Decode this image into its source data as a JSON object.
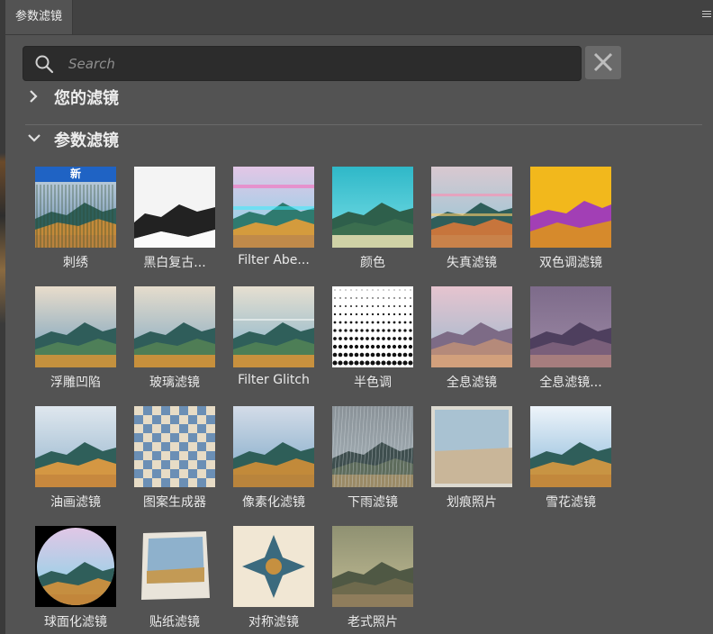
{
  "panel": {
    "tab_title": "参数滤镜",
    "menu_icon": "hamburger-icon"
  },
  "search": {
    "placeholder": "Search",
    "value": "",
    "icon": "search-icon",
    "clear_icon": "close-icon"
  },
  "sections": [
    {
      "label": "您的滤镜",
      "expanded": false
    },
    {
      "label": "参数滤镜",
      "expanded": true
    }
  ],
  "filters": [
    {
      "label": "刺绣",
      "badge": "新"
    },
    {
      "label": "黑白复古..."
    },
    {
      "label": "Filter Abe..."
    },
    {
      "label": "颜色"
    },
    {
      "label": "失真滤镜"
    },
    {
      "label": "双色调滤镜"
    },
    {
      "label": "浮雕凹陷"
    },
    {
      "label": "玻璃滤镜"
    },
    {
      "label": "Filter Glitch"
    },
    {
      "label": "半色调"
    },
    {
      "label": "全息滤镜"
    },
    {
      "label": "全息滤镜..."
    },
    {
      "label": "油画滤镜"
    },
    {
      "label": "图案生成器"
    },
    {
      "label": "像素化滤镜"
    },
    {
      "label": "下雨滤镜"
    },
    {
      "label": "划痕照片"
    },
    {
      "label": "雪花滤镜"
    },
    {
      "label": "球面化滤镜"
    },
    {
      "label": "贴纸滤镜"
    },
    {
      "label": "对称滤镜"
    },
    {
      "label": "老式照片"
    }
  ],
  "colors": {
    "panel_bg": "#535353",
    "search_bg": "#2c2c2c",
    "badge_bg": "#1f63c4"
  }
}
